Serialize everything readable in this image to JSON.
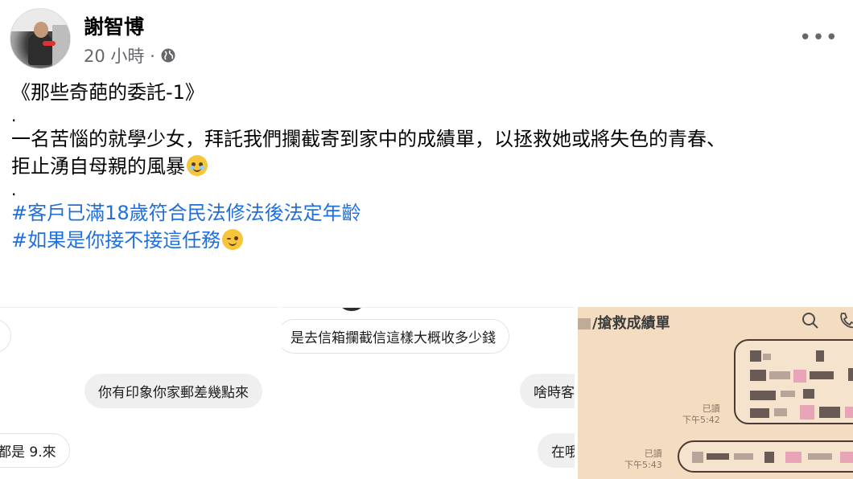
{
  "post": {
    "author": "謝智博",
    "time": "20 小時 ·",
    "more": "•••",
    "lines": {
      "title": "《那些奇葩的委託-1》",
      "dot1": ".",
      "body1": "一名苦惱的就學少女，拜託我們攔截寄到家中的成績單，以拯救她或將失色的青春、",
      "body2": "拒止湧自母親的風暴",
      "dot2": ".",
      "tag1": "#客戶已滿18歲符合民法修法後法定年齡",
      "tag2": "#如果是你接不接這任務"
    }
  },
  "photos": {
    "photo1": {
      "bubble1": "",
      "bubble2": "你有印象你家郵差幾點來",
      "bubble3": "都是 9.來"
    },
    "photo2": {
      "bubble1": "是去信箱攔截信這樣大概收多少錢",
      "bubble2": "啥時客",
      "bubble3": "在哦"
    },
    "photo3": {
      "title": "/搶救成績單",
      "read1_label": "已讀",
      "read1_time": "下午5:42",
      "read2_label": "已讀",
      "read2_time": "下午5:43"
    }
  },
  "colors": {
    "hashtag": "#216fdb",
    "meta_text": "#65676b",
    "chat_bg": "#f4dcc0"
  }
}
